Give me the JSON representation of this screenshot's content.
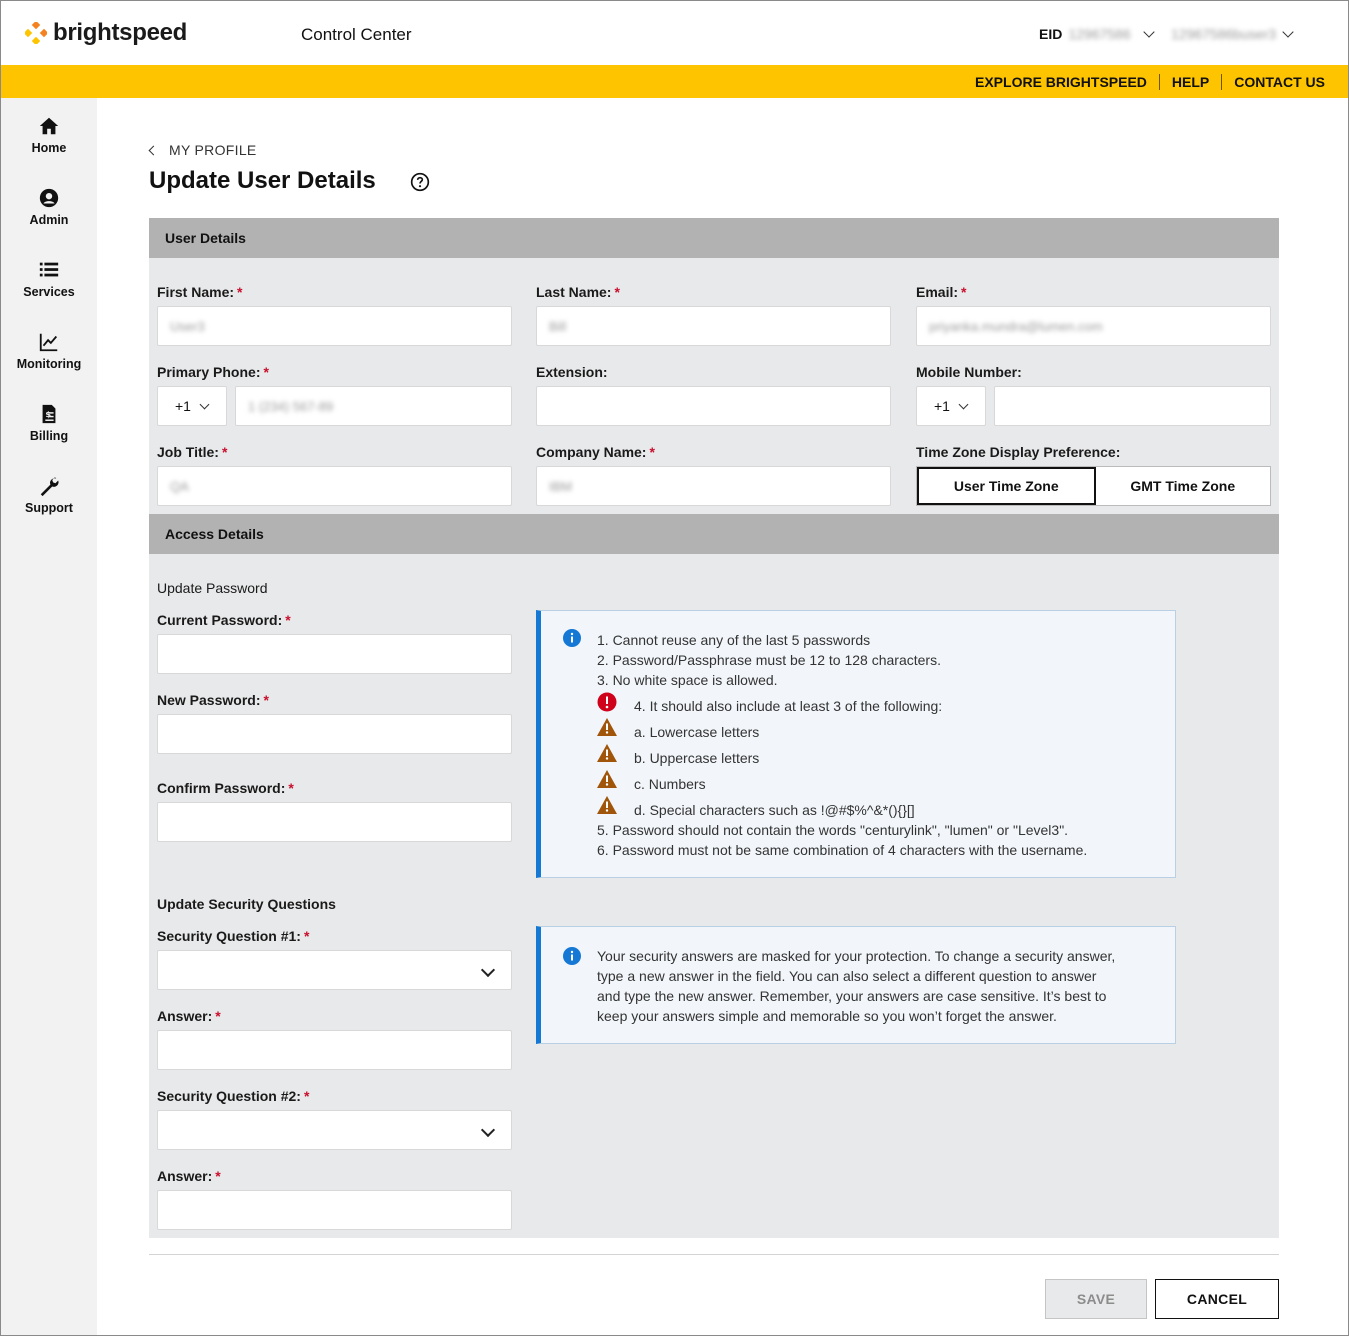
{
  "header": {
    "brand": "brightspeed",
    "app_title": "Control Center",
    "eid_label": "EID",
    "eid_value": "12967586",
    "user_value": "12967586buser3"
  },
  "top_links": [
    "EXPLORE BRIGHTSPEED",
    "HELP",
    "CONTACT US"
  ],
  "sidebar": {
    "items": [
      {
        "label": "Home",
        "icon": "home-icon"
      },
      {
        "label": "Admin",
        "icon": "user-circle-icon"
      },
      {
        "label": "Services",
        "icon": "list-icon"
      },
      {
        "label": "Monitoring",
        "icon": "chart-line-icon"
      },
      {
        "label": "Billing",
        "icon": "invoice-icon"
      },
      {
        "label": "Support",
        "icon": "wrench-icon"
      }
    ]
  },
  "breadcrumb": "MY PROFILE",
  "page_title": "Update User Details",
  "user_details": {
    "section_title": "User Details",
    "first_name": {
      "label": "First Name:",
      "value": "User3"
    },
    "last_name": {
      "label": "Last Name:",
      "value": "Bill"
    },
    "email": {
      "label": "Email:",
      "value": "priyanka.mundra@lumen.com"
    },
    "primary_phone": {
      "label": "Primary Phone:",
      "country_code": "+1",
      "value": "1 (234) 567-89"
    },
    "extension": {
      "label": "Extension:",
      "value": ""
    },
    "mobile": {
      "label": "Mobile Number:",
      "country_code": "+1",
      "value": ""
    },
    "job_title": {
      "label": "Job Title:",
      "value": "QA"
    },
    "company_name": {
      "label": "Company Name:",
      "value": "IBM"
    },
    "time_zone": {
      "label": "Time Zone Display Preference:",
      "options": [
        "User Time Zone",
        "GMT Time Zone"
      ],
      "selected": "User Time Zone"
    }
  },
  "access_details": {
    "section_title": "Access Details",
    "update_password_title": "Update Password",
    "current_password_label": "Current Password:",
    "new_password_label": "New Password:",
    "confirm_password_label": "Confirm Password:",
    "password_rules": [
      "1. Cannot reuse any of the last 5 passwords",
      "2. Password/Passphrase must be 12 to 128 characters.",
      "3. No white space is allowed.",
      "4. It should also include at least 3 of the following:",
      "a. Lowercase letters",
      "b. Uppercase letters",
      "c. Numbers",
      "d. Special characters such as !@#$%^&*(){}[]",
      "5. Password should not contain the words \"centurylink\", \"lumen\" or \"Level3\".",
      "6. Password must not be same combination of 4 characters with the username."
    ],
    "security_title": "Update Security Questions",
    "question1_label": "Security Question #1:",
    "answer1_label": "Answer:",
    "question2_label": "Security Question #2:",
    "answer2_label": "Answer:",
    "security_info_lines": [
      "Your security answers are masked for your protection. To change a security answer,",
      "type a new answer in the field. You can also select a different question to answer",
      "and type the new answer. Remember, your answers are case sensitive. It’s best to",
      "keep your answers simple and memorable so you won’t forget the answer."
    ]
  },
  "actions": {
    "save": "SAVE",
    "cancel": "CANCEL"
  },
  "colors": {
    "brand_yellow": "#fec400",
    "info_blue": "#1478d4",
    "error_red": "#d0021b",
    "warning_brown": "#a0550a"
  }
}
